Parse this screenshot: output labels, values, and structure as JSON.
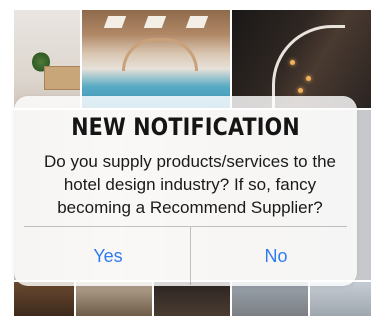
{
  "notification": {
    "title": "NEW NOTIFICATION",
    "message": "Do you supply products/services to the hotel design industry? If so, fancy becoming a Recommend Supplier?",
    "yes_label": "Yes",
    "no_label": "No"
  },
  "colors": {
    "button_text": "#2f7cf0",
    "title_text": "#151515",
    "dialog_background": "rgba(255,255,255,0.82)"
  }
}
